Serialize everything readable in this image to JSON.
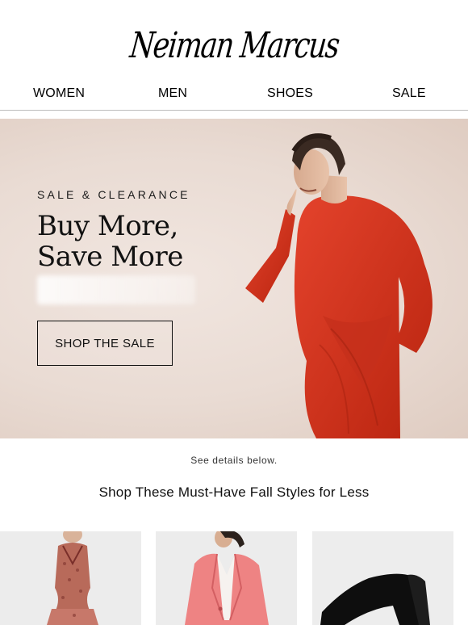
{
  "brand": {
    "logo_text": "Neiman Marcus"
  },
  "nav": {
    "items": [
      {
        "label": "WOMEN"
      },
      {
        "label": "MEN"
      },
      {
        "label": "SHOES"
      },
      {
        "label": "SALE"
      }
    ]
  },
  "hero": {
    "kicker": "SALE & CLEARANCE",
    "title_line1": "Buy More,",
    "title_line2": "Save More",
    "cta_label": "SHOP THE SALE",
    "colors": {
      "background": "#e9dbd3",
      "dress": "#d9301e"
    }
  },
  "details_text": "See details below.",
  "section_title": "Shop These Must-Have Fall Styles for Less",
  "products": [
    {
      "image": "printed-ruffle-dress"
    },
    {
      "image": "pink-blazer"
    },
    {
      "image": "black-platform-mule"
    }
  ]
}
